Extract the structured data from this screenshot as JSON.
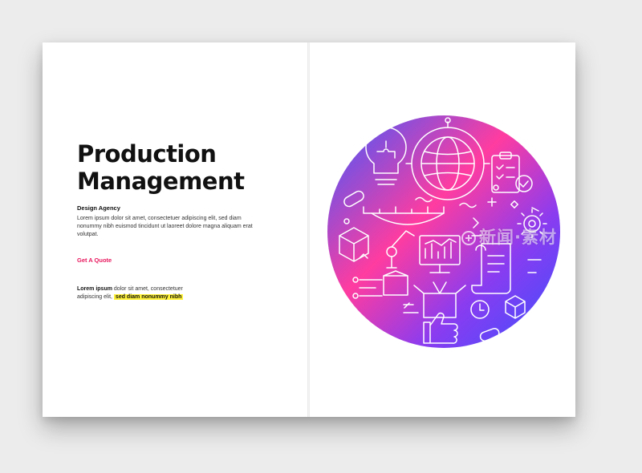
{
  "brochure": {
    "title_line1": "Production",
    "title_line2": "Management",
    "agency": "Design Agency",
    "body": "Lorem ipsum dolor sit amet, consectetuer adipiscing elit, sed diam nonummy nibh euismod tincidunt ut laoreet dolore magna aliquam erat volutpat.",
    "cta_label": "Get A Quote",
    "note": {
      "bold": "Lorem ipsum",
      "text": " dolor sit amet, consectetuer adipiscing elit, ",
      "highlight": "sed diam nonummy nibh"
    }
  },
  "illustration": {
    "icons": [
      "puzzle-lightbulb",
      "globe",
      "clipboard-checklist",
      "gear",
      "box",
      "robotic-arm",
      "conveyor-belt",
      "monitor-chart",
      "open-box",
      "document-scroll",
      "clock",
      "thumbs-up",
      "cube",
      "pill"
    ],
    "gradient_colors": [
      "#3b5bff",
      "#ff3ca0",
      "#4a3cff"
    ]
  },
  "watermark": {
    "text": "新闻·素材"
  },
  "colors": {
    "accent": "#e8175d",
    "highlight": "#fff23a",
    "background": "#ececec"
  }
}
